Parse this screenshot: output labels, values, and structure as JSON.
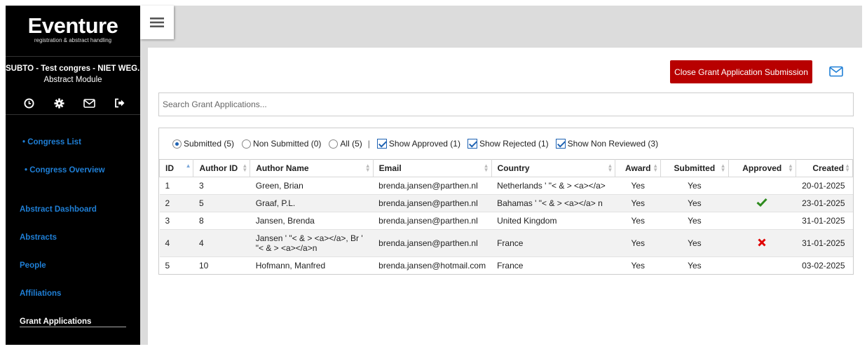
{
  "brand": {
    "name": "Eventure",
    "tagline": "registration & abstract handling"
  },
  "sidebar": {
    "congress_name": "SUBTO - Test congres - NIET WEG...",
    "module": "Abstract Module",
    "icons": [
      "clock-icon",
      "gear-icon",
      "envelope-icon",
      "logout-icon"
    ],
    "sub_items": [
      "• Congress List",
      "• Congress Overview"
    ],
    "items": [
      "Abstract Dashboard",
      "Abstracts",
      "People",
      "Affiliations",
      "Grant Applications"
    ],
    "active_item": "Grant Applications"
  },
  "toolbar": {
    "close_label": "Close Grant Application Submission"
  },
  "search": {
    "placeholder": "Search Grant Applications..."
  },
  "filters": {
    "submitted": "Submitted (5)",
    "non_submitted": "Non Submitted (0)",
    "all": "All (5)",
    "separator": "|",
    "show_approved": "Show Approved (1)",
    "show_rejected": "Show Rejected (1)",
    "show_non_reviewed": "Show Non Reviewed (3)",
    "selected_radio": "submitted"
  },
  "table": {
    "headers": [
      "ID",
      "Author ID",
      "Author Name",
      "Email",
      "Country",
      "Award",
      "Submitted",
      "Approved",
      "Created"
    ],
    "rows": [
      {
        "id": "1",
        "author_id": "3",
        "author_name": "Green, Brian",
        "email": "brenda.jansen@parthen.nl",
        "country": "Netherlands ' \"< & > <a></a>",
        "award": "Yes",
        "submitted": "Yes",
        "approved": "",
        "created": "20-01-2025"
      },
      {
        "id": "2",
        "author_id": "5",
        "author_name": "Graaf, P.L.",
        "email": "brenda.jansen@parthen.nl",
        "country": "Bahamas ' \"< & > <a></a> n",
        "award": "Yes",
        "submitted": "Yes",
        "approved": "check",
        "created": "23-01-2025"
      },
      {
        "id": "3",
        "author_id": "8",
        "author_name": "Jansen, Brenda",
        "email": "brenda.jansen@parthen.nl",
        "country": "United Kingdom",
        "award": "Yes",
        "submitted": "Yes",
        "approved": "",
        "created": "31-01-2025"
      },
      {
        "id": "4",
        "author_id": "4",
        "author_name": "Jansen ' \"< & > <a></a>, Br ' \"< & > <a></a>n",
        "email": "brenda.jansen@parthen.nl",
        "country": "France",
        "award": "Yes",
        "submitted": "Yes",
        "approved": "cross",
        "created": "31-01-2025"
      },
      {
        "id": "5",
        "author_id": "10",
        "author_name": "Hofmann, Manfred",
        "email": "brenda.jansen@hotmail.com",
        "country": "France",
        "award": "Yes",
        "submitted": "Yes",
        "approved": "",
        "created": "03-02-2025"
      }
    ]
  },
  "colors": {
    "accent_blue": "#1f7fd6",
    "close_button": "#b80000",
    "approved_green": "#2e8b1e",
    "rejected_red": "#e00000"
  }
}
